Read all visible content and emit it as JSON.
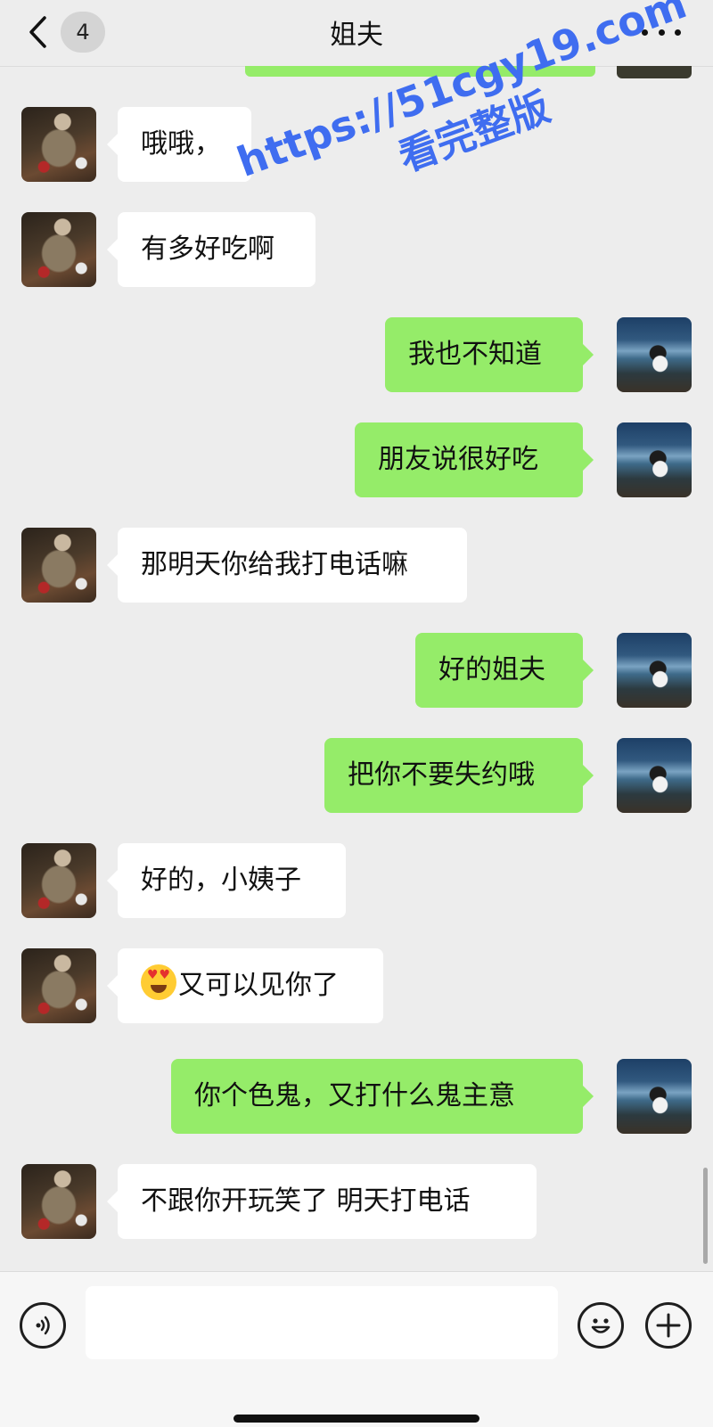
{
  "header": {
    "title": "姐夫",
    "unread_count": "4"
  },
  "messages": [
    {
      "side": "left",
      "sender": "姐夫",
      "text": "哦哦，"
    },
    {
      "side": "left",
      "sender": "姐夫",
      "text": "有多好吃啊"
    },
    {
      "side": "right",
      "sender": "me",
      "text": "我也不知道"
    },
    {
      "side": "right",
      "sender": "me",
      "text": "朋友说很好吃"
    },
    {
      "side": "left",
      "sender": "姐夫",
      "text": "那明天你给我打电话嘛"
    },
    {
      "side": "right",
      "sender": "me",
      "text": "好的姐夫"
    },
    {
      "side": "right",
      "sender": "me",
      "text": "把你不要失约哦"
    },
    {
      "side": "left",
      "sender": "姐夫",
      "text": "好的，小姨子"
    },
    {
      "side": "left",
      "sender": "姐夫",
      "emoji": "heart-eyes",
      "text": "又可以见你了"
    },
    {
      "side": "right",
      "sender": "me",
      "text": "你个色鬼，又打什么鬼主意"
    },
    {
      "side": "left",
      "sender": "姐夫",
      "text": "不跟你开玩笑了 明天打电话"
    }
  ],
  "watermark": {
    "line1": "https://51cgy19.com",
    "line2": "看完整版"
  },
  "input": {
    "value": "",
    "placeholder": ""
  },
  "icons": {
    "back": "chevron-left-icon",
    "more": "more-dots-icon",
    "voice": "voice-icon",
    "emoji": "emoji-icon",
    "plus": "plus-icon"
  },
  "colors": {
    "sent_bubble": "#95ec69",
    "received_bubble": "#ffffff",
    "background": "#ededed",
    "watermark": "#3f6df0"
  }
}
